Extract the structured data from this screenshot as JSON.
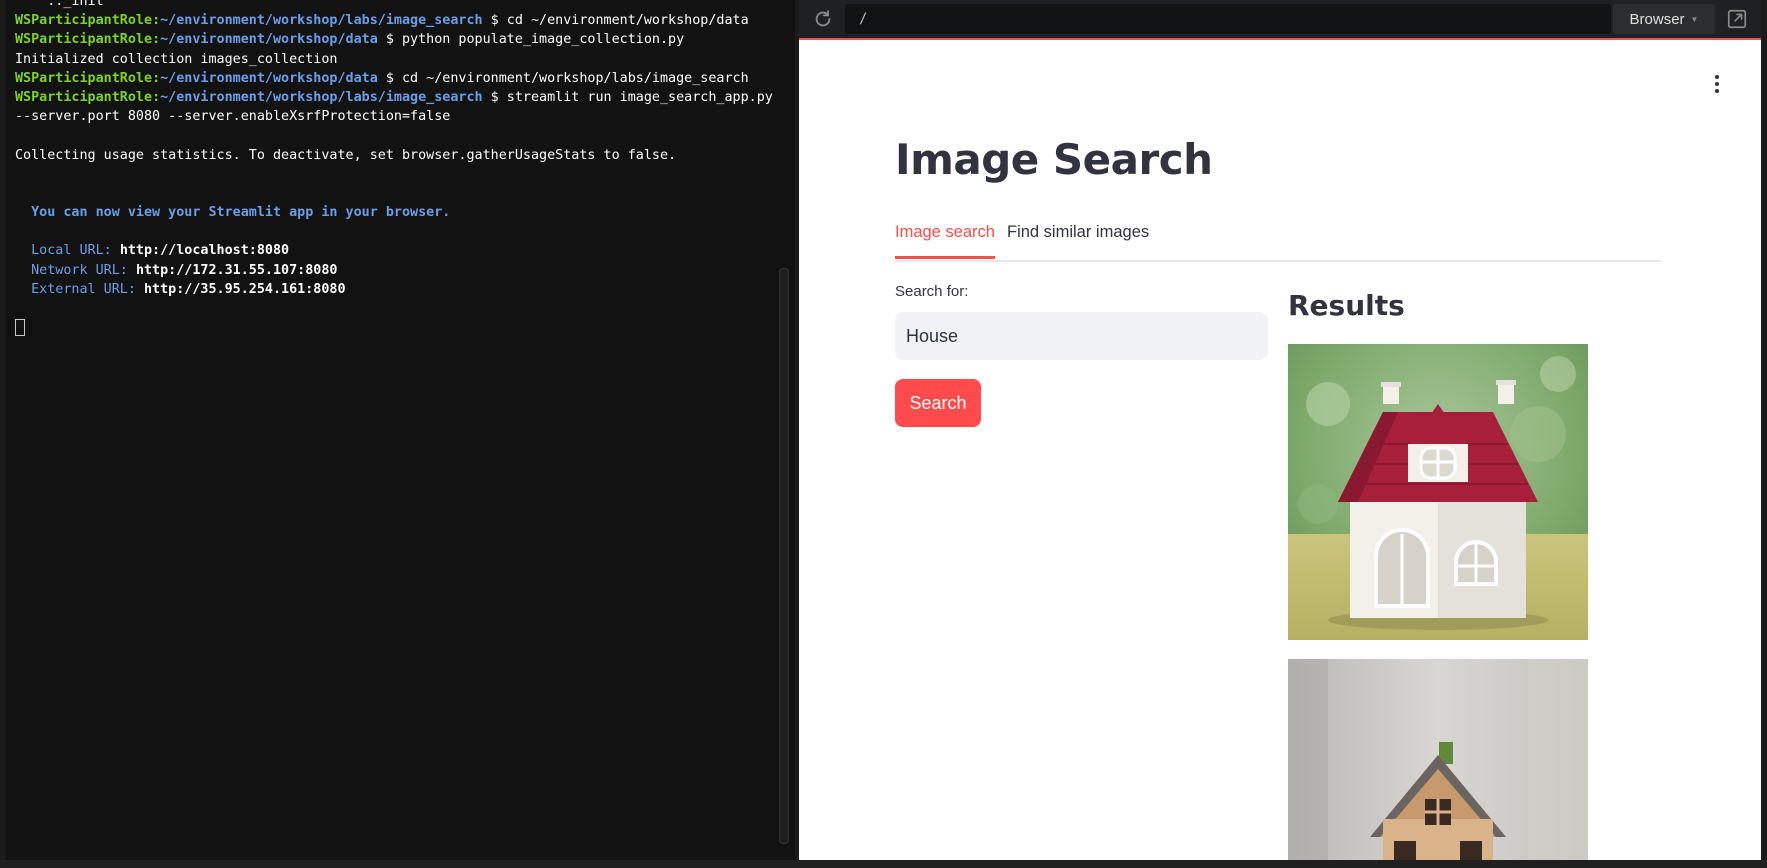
{
  "terminal": {
    "top_fragment": "    .._init",
    "lines": [
      {
        "kind": "prompt",
        "user": "WSParticipantRole",
        "path": "~/environment/workshop/labs/image_search",
        "cmd": "cd ~/environment/workshop/data"
      },
      {
        "kind": "prompt",
        "user": "WSParticipantRole",
        "path": "~/environment/workshop/data",
        "cmd": "python populate_image_collection.py"
      },
      {
        "kind": "out",
        "text": "Initialized collection images_collection"
      },
      {
        "kind": "prompt",
        "user": "WSParticipantRole",
        "path": "~/environment/workshop/data",
        "cmd": "cd ~/environment/workshop/labs/image_search"
      },
      {
        "kind": "prompt",
        "user": "WSParticipantRole",
        "path": "~/environment/workshop/labs/image_search",
        "cmd": "streamlit run image_search_app.py"
      },
      {
        "kind": "out",
        "text": "--server.port 8080 --server.enableXsrfProtection=false"
      },
      {
        "kind": "blank"
      },
      {
        "kind": "out",
        "text": "Collecting usage statistics. To deactivate, set browser.gatherUsageStats to false."
      },
      {
        "kind": "blank"
      },
      {
        "kind": "blank"
      },
      {
        "kind": "info",
        "text": "  You can now view your Streamlit app in your browser."
      },
      {
        "kind": "blank"
      },
      {
        "kind": "url",
        "label": "  Local URL: ",
        "url": "http://localhost:8080"
      },
      {
        "kind": "url",
        "label": "  Network URL: ",
        "url": "http://172.31.55.107:8080"
      },
      {
        "kind": "url",
        "label": "  External URL: ",
        "url": "http://35.95.254.161:8080"
      },
      {
        "kind": "blank"
      },
      {
        "kind": "cursor"
      }
    ]
  },
  "browser": {
    "url": "/",
    "mode_button": "Browser",
    "accent": "#ff4b4b"
  },
  "app": {
    "title": "Image Search",
    "tabs": [
      {
        "label": "Image search",
        "active": true
      },
      {
        "label": "Find similar images",
        "active": false
      }
    ],
    "search": {
      "label": "Search for:",
      "value": "House",
      "button": "Search"
    },
    "results": {
      "heading": "Results",
      "images": [
        "red-roof-toy-house-photo",
        "wooden-model-house-photo"
      ]
    }
  },
  "icons": {
    "reload": "reload-icon",
    "popout": "popout-icon",
    "menu": "kebab-menu-icon"
  }
}
